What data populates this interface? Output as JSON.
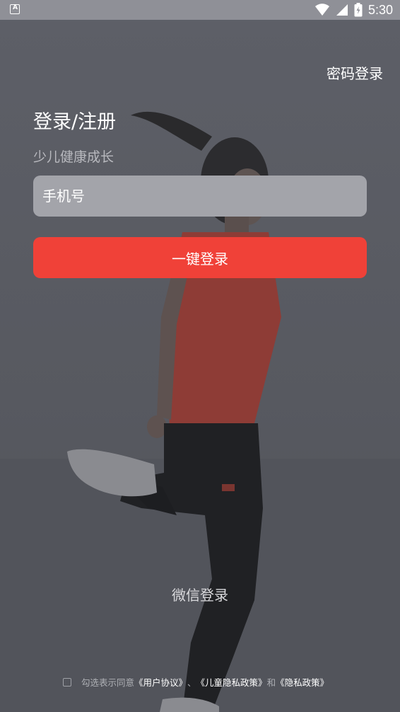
{
  "status_bar": {
    "time": "5:30",
    "notification_icon": "a-badge-icon",
    "wifi_icon": "wifi-icon",
    "signal_icon": "cell-signal-icon",
    "battery_icon": "battery-icon"
  },
  "header": {
    "password_login_label": "密码登录"
  },
  "main": {
    "title": "登录/注册",
    "subtitle": "少儿健康成长",
    "phone_placeholder": "手机号",
    "phone_value": "",
    "one_click_login_label": "一键登录"
  },
  "footer": {
    "wechat_login_label": "微信登录",
    "agreement": {
      "checked": false,
      "prefix": "勾选表示同意",
      "user_agreement": "《用户协议》",
      "separator": "、",
      "child_privacy_policy": "《儿童隐私政策》",
      "conjunction": "和",
      "privacy_policy": "《隐私政策》"
    }
  },
  "colors": {
    "primary_button": "#f04138",
    "input_background": "#a3a4aa",
    "overlay_background": "#55575f"
  }
}
